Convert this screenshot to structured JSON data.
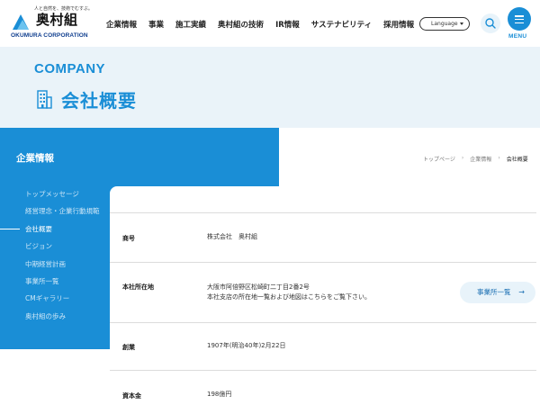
{
  "header": {
    "logo": {
      "tagline": "人と自然を、技術でむすぶ。",
      "name_jp": "奥村組",
      "name_en": "OKUMURA CORPORATION"
    },
    "nav": [
      "企業情報",
      "事業",
      "施工実績",
      "奥村組の技術",
      "IR情報",
      "サステナビリティ",
      "採用情報"
    ],
    "language_label": "Language",
    "menu_label": "MENU"
  },
  "hero": {
    "label_en": "COMPANY",
    "title": "会社概要"
  },
  "sidebar": {
    "title": "企業情報",
    "items": [
      {
        "label": "トップメッセージ"
      },
      {
        "label": "経営理念・企業行動規範"
      },
      {
        "label": "会社概要",
        "active": true
      },
      {
        "label": "ビジョン"
      },
      {
        "label": "中期経営計画"
      },
      {
        "label": "事業所一覧"
      },
      {
        "label": "CMギャラリー"
      },
      {
        "label": "奥村組の歩み"
      }
    ]
  },
  "breadcrumb": {
    "items": [
      "トップページ",
      "企業情報",
      "会社概要"
    ]
  },
  "profile": {
    "rows": [
      {
        "label": "商号",
        "value": [
          "株式会社　奥村組"
        ]
      },
      {
        "label": "本社所在地",
        "value": [
          "大阪市阿倍野区松崎町二丁目2番2号",
          "本社支店の所在地一覧および地図はこちらをご覧下さい。"
        ]
      },
      {
        "label": "創業",
        "value": [
          "1907年(明治40年)2月22日"
        ]
      },
      {
        "label": "資本金",
        "value": [
          "198億円"
        ]
      }
    ],
    "office_button": "事業所一覧"
  },
  "colors": {
    "brand_blue": "#1a8ed6",
    "hero_bg": "#eaf3f9",
    "logo_navy": "#0e3d8e"
  },
  "icons": {
    "search": "search-icon",
    "menu": "hamburger-icon",
    "arrow": "arrow-right-icon",
    "building": "building-icon"
  }
}
